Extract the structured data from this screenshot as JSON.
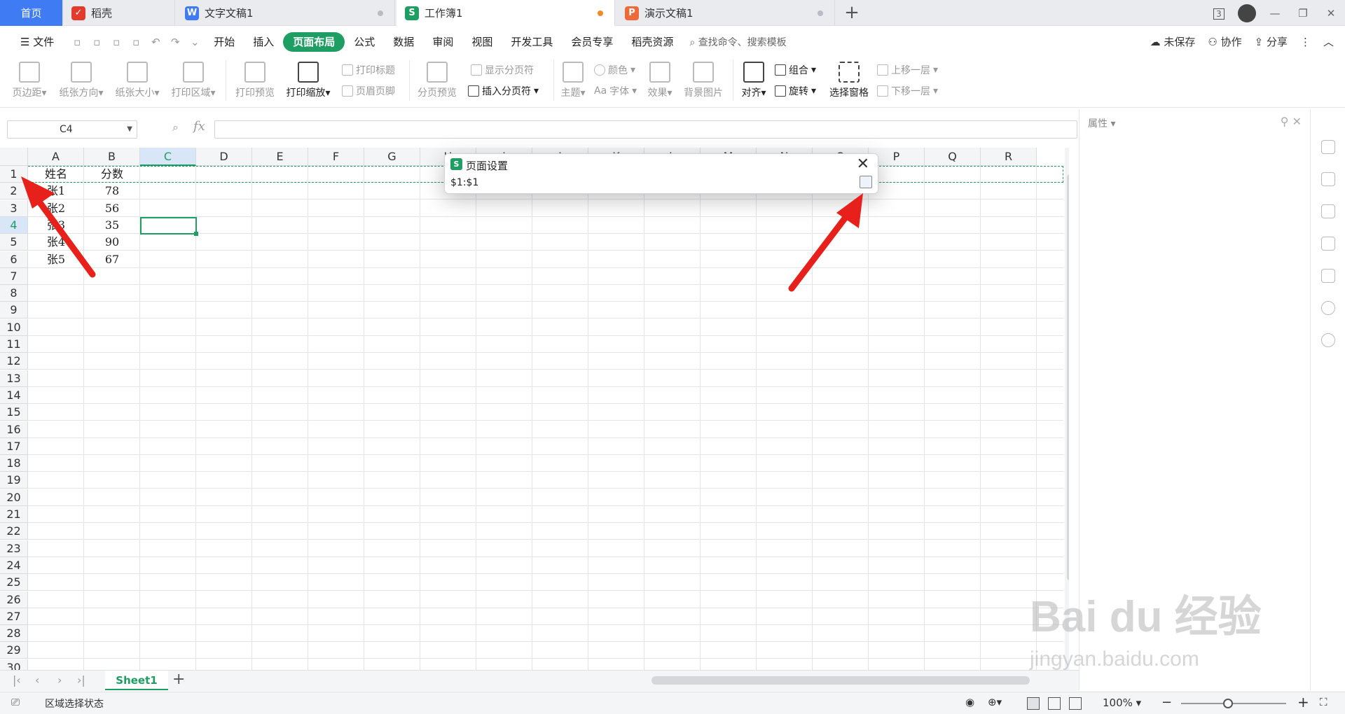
{
  "tabs": {
    "home": "首页",
    "daoke": "稻壳",
    "doc": "文字文稿1",
    "book": "工作簿1",
    "ppt": "演示文稿1",
    "book_icon": "S",
    "doc_icon": "W",
    "ppt_icon": "P"
  },
  "window": {
    "badge": "3"
  },
  "menu": {
    "file": "文件",
    "items": [
      "开始",
      "插入",
      "页面布局",
      "公式",
      "数据",
      "审阅",
      "视图",
      "开发工具",
      "会员专享",
      "稻壳资源"
    ],
    "active": "页面布局",
    "search": "查找命令、搜索模板",
    "unsaved": "未保存",
    "collab": "协作",
    "share": "分享"
  },
  "ribbon": {
    "margins": "页边距",
    "orientation": "纸张方向",
    "size": "纸张大小",
    "print_area": "打印区域",
    "print_preview": "打印预览",
    "print_scale": "打印缩放",
    "print_titles": "打印标题",
    "header_footer": "页眉页脚",
    "page_break_preview": "分页预览",
    "show_breaks": "显示分页符",
    "insert_break": "插入分页符",
    "theme": "主题",
    "colors": "颜色",
    "fonts": "字体",
    "effects": "效果",
    "background": "背景图片",
    "align": "对齐",
    "group": "组合",
    "rotate": "旋转",
    "selection_pane": "选择窗格",
    "bring_forward": "上移一层",
    "send_backward": "下移一层"
  },
  "formula_bar": {
    "name_box": "C4",
    "fx": "fx",
    "content": ""
  },
  "sheet": {
    "columns": [
      "A",
      "B",
      "C",
      "D",
      "E",
      "F",
      "G",
      "H",
      "I",
      "J",
      "K",
      "L",
      "M",
      "N",
      "O",
      "P",
      "Q",
      "R"
    ],
    "rows": [
      "1",
      "2",
      "3",
      "4",
      "5",
      "6",
      "7",
      "8",
      "9",
      "10",
      "11",
      "12",
      "13",
      "14",
      "15",
      "16",
      "17",
      "18",
      "19",
      "20",
      "21",
      "22",
      "23",
      "24",
      "25",
      "26",
      "27",
      "28",
      "29",
      "30"
    ],
    "selected_cell": "C4",
    "data": [
      [
        "姓名",
        "分数"
      ],
      [
        "张1",
        "78"
      ],
      [
        "张2",
        "56"
      ],
      [
        "张3",
        "35"
      ],
      [
        "张4",
        "90"
      ],
      [
        "张5",
        "67"
      ]
    ]
  },
  "dialog": {
    "title": "页面设置",
    "value": "$1:$1"
  },
  "right_panel": {
    "title": "属性"
  },
  "sheet_tabs": {
    "active": "Sheet1"
  },
  "status": {
    "text": "区域选择状态",
    "zoom": "100%"
  },
  "watermark": {
    "logo": "Bai du 经验",
    "url": "jingyan.baidu.com"
  }
}
